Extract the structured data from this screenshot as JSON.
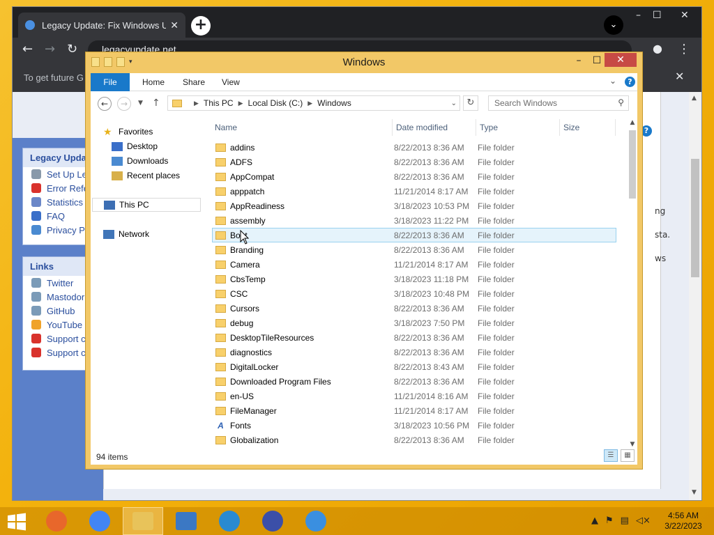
{
  "browser": {
    "tab_title": "Legacy Update: Fix Windows Update",
    "url": "legacyupdate.net",
    "infobar_text": "To get future G",
    "window_controls": {
      "minimize": "–",
      "maximize": "☐",
      "close": "✕"
    }
  },
  "website": {
    "sidebar_heading": "Legacy Upda",
    "sidebar_items": [
      {
        "label": "Set Up Le",
        "icon": "setup-icon",
        "color": "#8899aa"
      },
      {
        "label": "Error Refe",
        "icon": "error-icon",
        "color": "#d9322c"
      },
      {
        "label": "Statistics",
        "icon": "statistics-icon",
        "color": "#6b87c8"
      },
      {
        "label": "FAQ",
        "icon": "help-icon",
        "color": "#3a6fc9"
      },
      {
        "label": "Privacy Po",
        "icon": "privacy-icon",
        "color": "#4a8ad1"
      }
    ],
    "links_heading": "Links",
    "links": [
      {
        "label": "Twitter",
        "icon": "users-icon",
        "color": "#7b9bb8"
      },
      {
        "label": "Mastodor",
        "icon": "users-icon",
        "color": "#7b9bb8"
      },
      {
        "label": "GitHub",
        "icon": "users-icon",
        "color": "#7b9bb8"
      },
      {
        "label": "YouTube",
        "icon": "media-icon",
        "color": "#f0a32a"
      },
      {
        "label": "Support c",
        "icon": "heart-icon",
        "color": "#d9322c"
      },
      {
        "label": "Support c",
        "icon": "heart-icon",
        "color": "#d9322c"
      }
    ],
    "text_fragments": [
      "ng",
      "sta.",
      "ws"
    ]
  },
  "explorer": {
    "title": "Windows",
    "ribbon_tabs": [
      "File",
      "Home",
      "Share",
      "View"
    ],
    "breadcrumb": [
      "This PC",
      "Local Disk (C:)",
      "Windows"
    ],
    "search_placeholder": "Search Windows",
    "nav": {
      "favorites": "Favorites",
      "desktop": "Desktop",
      "downloads": "Downloads",
      "recent": "Recent places",
      "thispc": "This PC",
      "network": "Network"
    },
    "columns": {
      "name": "Name",
      "date": "Date modified",
      "type": "Type",
      "size": "Size"
    },
    "files": [
      {
        "name": "addins",
        "date": "8/22/2013 8:36 AM",
        "type": "File folder"
      },
      {
        "name": "ADFS",
        "date": "8/22/2013 8:36 AM",
        "type": "File folder"
      },
      {
        "name": "AppCompat",
        "date": "8/22/2013 8:36 AM",
        "type": "File folder"
      },
      {
        "name": "apppatch",
        "date": "11/21/2014 8:17 AM",
        "type": "File folder"
      },
      {
        "name": "AppReadiness",
        "date": "3/18/2023 10:53 PM",
        "type": "File folder"
      },
      {
        "name": "assembly",
        "date": "3/18/2023 11:22 PM",
        "type": "File folder"
      },
      {
        "name": "Boot",
        "date": "8/22/2013 8:36 AM",
        "type": "File folder",
        "selected": true
      },
      {
        "name": "Branding",
        "date": "8/22/2013 8:36 AM",
        "type": "File folder"
      },
      {
        "name": "Camera",
        "date": "11/21/2014 8:17 AM",
        "type": "File folder"
      },
      {
        "name": "CbsTemp",
        "date": "3/18/2023 11:18 PM",
        "type": "File folder"
      },
      {
        "name": "CSC",
        "date": "3/18/2023 10:48 PM",
        "type": "File folder"
      },
      {
        "name": "Cursors",
        "date": "8/22/2013 8:36 AM",
        "type": "File folder"
      },
      {
        "name": "debug",
        "date": "3/18/2023 7:50 PM",
        "type": "File folder"
      },
      {
        "name": "DesktopTileResources",
        "date": "8/22/2013 8:36 AM",
        "type": "File folder"
      },
      {
        "name": "diagnostics",
        "date": "8/22/2013 8:36 AM",
        "type": "File folder"
      },
      {
        "name": "DigitalLocker",
        "date": "8/22/2013 8:43 AM",
        "type": "File folder"
      },
      {
        "name": "Downloaded Program Files",
        "date": "8/22/2013 8:36 AM",
        "type": "File folder"
      },
      {
        "name": "en-US",
        "date": "11/21/2014 8:16 AM",
        "type": "File folder"
      },
      {
        "name": "FileManager",
        "date": "11/21/2014 8:17 AM",
        "type": "File folder"
      },
      {
        "name": "Fonts",
        "date": "3/18/2023 10:56 PM",
        "type": "File folder",
        "icon": "fonts"
      },
      {
        "name": "Globalization",
        "date": "8/22/2013 8:36 AM",
        "type": "File folder"
      }
    ],
    "item_count": "94 items"
  },
  "taskbar": {
    "apps": [
      {
        "name": "firefox",
        "color": "#e8672b"
      },
      {
        "name": "chrome",
        "color": "#4285f4"
      },
      {
        "name": "file-explorer",
        "color": "#e8c35a",
        "active": true
      },
      {
        "name": "control-panel",
        "color": "#3b78c4"
      },
      {
        "name": "internet-explorer",
        "color": "#2a8ad1"
      },
      {
        "name": "settings",
        "color": "#3b4fa8"
      },
      {
        "name": "legacy-update",
        "color": "#3a8fe0"
      }
    ],
    "time": "4:56 AM",
    "date": "3/22/2023"
  },
  "colors": {
    "accent": "#1979ca",
    "explorer_frame": "#f2c867",
    "selection": "#e5f3fb"
  }
}
